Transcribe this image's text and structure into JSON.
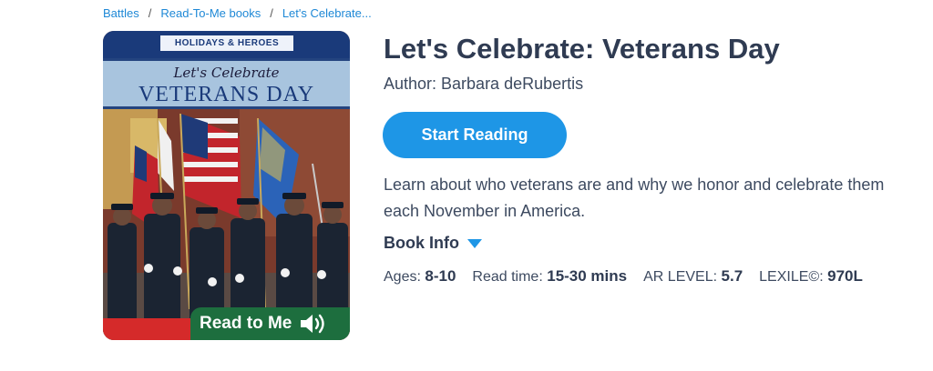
{
  "breadcrumb": {
    "items": [
      "Battles",
      "Read-To-Me books",
      "Let's Celebrate..."
    ],
    "separator": "/"
  },
  "cover": {
    "series": "HOLIDAYS & HEROES",
    "subtitle": "Let's Celebrate",
    "title": "VETERANS DAY",
    "badge": "Read to Me",
    "badge_icon": "speaker-icon"
  },
  "book": {
    "title": "Let's Celebrate: Veterans Day",
    "author": "Author: Barbara deRubertis",
    "description": "Learn about who veterans are and why we honor and celebrate them each November in America.",
    "info_label": "Book Info",
    "info_icon": "caret-down-icon"
  },
  "actions": {
    "start_reading": "Start Reading"
  },
  "stats": {
    "ages_label": "Ages:",
    "ages_value": "8-10",
    "read_time_label": "Read time:",
    "read_time_value": "15-30 mins",
    "ar_label": "AR LEVEL:",
    "ar_value": "5.7",
    "lexile_label": "LEXILE©:",
    "lexile_value": "970L"
  },
  "colors": {
    "accent": "#1e96e6",
    "link": "#1e88d6",
    "heading": "#2f3b52",
    "badge_green": "#1d6e3e"
  }
}
